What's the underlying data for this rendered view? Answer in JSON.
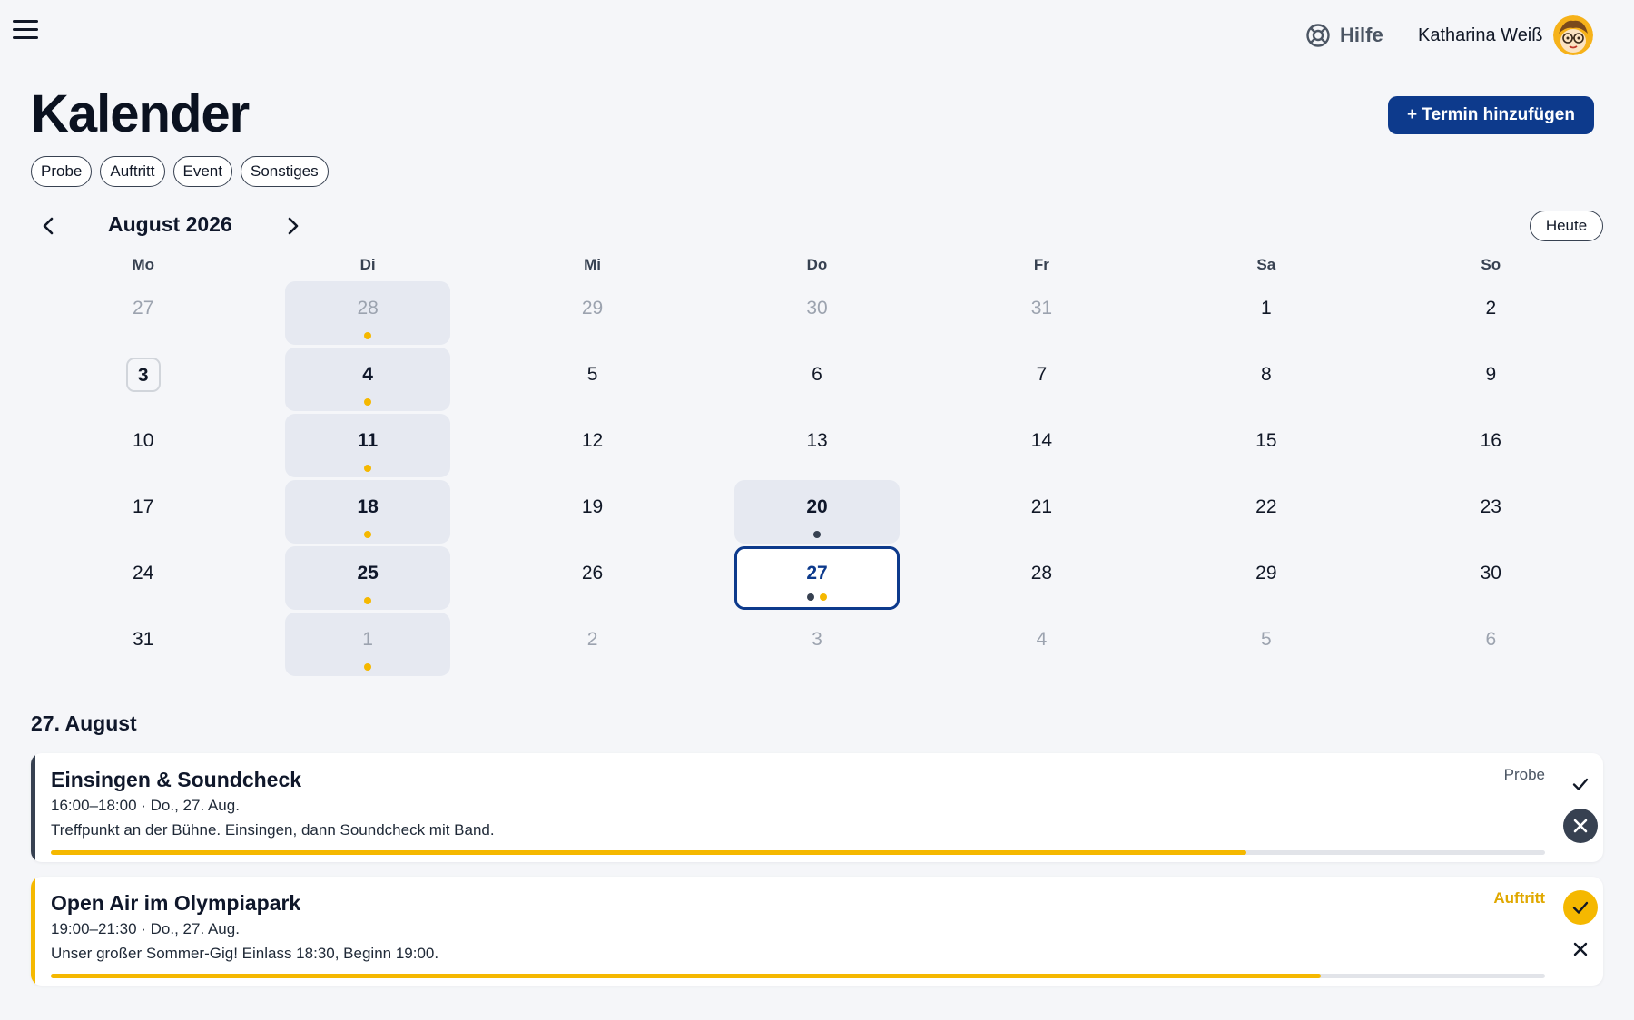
{
  "topbar": {
    "help_label": "Hilfe",
    "user_name": "Katharina Weiß"
  },
  "page": {
    "title": "Kalender",
    "add_button": "+ Termin hinzufügen"
  },
  "filters": [
    "Probe",
    "Auftritt",
    "Event",
    "Sonstiges"
  ],
  "calendar": {
    "month_label": "August 2026",
    "today_button": "Heute",
    "weekdays": [
      "Mo",
      "Di",
      "Mi",
      "Do",
      "Fr",
      "Sa",
      "So"
    ],
    "weeks": [
      [
        {
          "n": "27",
          "muted": true
        },
        {
          "n": "28",
          "muted": true,
          "shaded": true,
          "dots": [
            "yellow"
          ]
        },
        {
          "n": "29",
          "muted": true
        },
        {
          "n": "30",
          "muted": true
        },
        {
          "n": "31",
          "muted": true
        },
        {
          "n": "1"
        },
        {
          "n": "2"
        }
      ],
      [
        {
          "n": "3",
          "today": true
        },
        {
          "n": "4",
          "shaded": true,
          "bold": true,
          "dots": [
            "yellow"
          ]
        },
        {
          "n": "5"
        },
        {
          "n": "6"
        },
        {
          "n": "7"
        },
        {
          "n": "8"
        },
        {
          "n": "9"
        }
      ],
      [
        {
          "n": "10"
        },
        {
          "n": "11",
          "shaded": true,
          "bold": true,
          "dots": [
            "yellow"
          ]
        },
        {
          "n": "12"
        },
        {
          "n": "13"
        },
        {
          "n": "14"
        },
        {
          "n": "15"
        },
        {
          "n": "16"
        }
      ],
      [
        {
          "n": "17"
        },
        {
          "n": "18",
          "shaded": true,
          "bold": true,
          "dots": [
            "yellow"
          ]
        },
        {
          "n": "19"
        },
        {
          "n": "20",
          "shaded": true,
          "bold": true,
          "dots": [
            "dark"
          ]
        },
        {
          "n": "21"
        },
        {
          "n": "22"
        },
        {
          "n": "23"
        }
      ],
      [
        {
          "n": "24"
        },
        {
          "n": "25",
          "shaded": true,
          "bold": true,
          "dots": [
            "yellow"
          ]
        },
        {
          "n": "26"
        },
        {
          "n": "27",
          "selected": true,
          "dots": [
            "dark",
            "yellow"
          ]
        },
        {
          "n": "28"
        },
        {
          "n": "29"
        },
        {
          "n": "30"
        }
      ],
      [
        {
          "n": "31"
        },
        {
          "n": "1",
          "muted": true,
          "shaded": true,
          "dots": [
            "yellow"
          ]
        },
        {
          "n": "2",
          "muted": true
        },
        {
          "n": "3",
          "muted": true
        },
        {
          "n": "4",
          "muted": true
        },
        {
          "n": "5",
          "muted": true
        },
        {
          "n": "6",
          "muted": true
        }
      ]
    ]
  },
  "day_detail": {
    "title": "27. August",
    "events": [
      {
        "title": "Einsingen & Soundcheck",
        "time": "16:00–18:00 · Do., 27. Aug.",
        "description": "Treffpunkt an der Bühne. Einsingen, dann Soundcheck mit Band.",
        "type": "Probe",
        "type_color": "#4b5563",
        "accent_color": "#374151",
        "progress": 0.8,
        "response": "declined"
      },
      {
        "title": "Open Air im Olympiapark",
        "time": "19:00–21:30 · Do., 27. Aug.",
        "description": "Unser großer Sommer-Gig! Einlass 18:30, Beginn 19:00.",
        "type": "Auftritt",
        "type_color": "#e0a800",
        "accent_color": "#f5b800",
        "progress": 0.85,
        "response": "accepted"
      }
    ]
  },
  "colors": {
    "brand": "#0d3a8c",
    "accent_yellow": "#f5b800",
    "dark_dot": "#374151",
    "shaded_cell": "#e6e9f1"
  }
}
